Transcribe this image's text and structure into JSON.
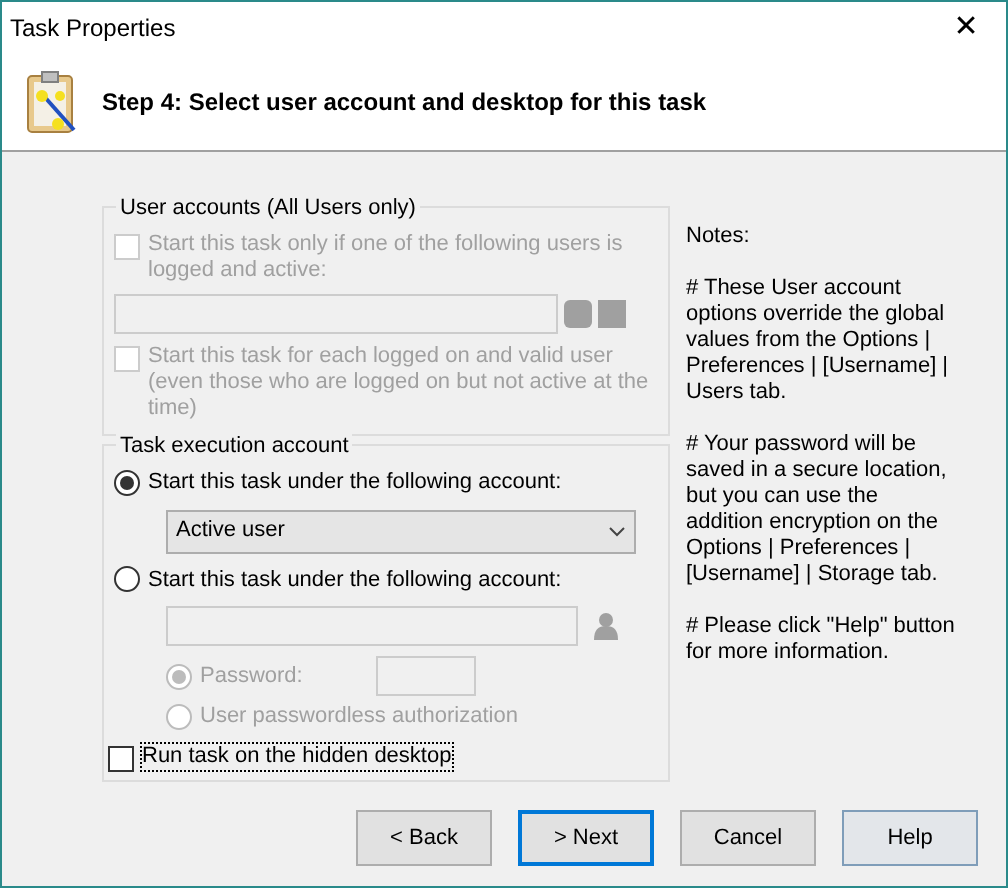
{
  "window": {
    "title": "Task Properties",
    "close": "✕"
  },
  "header": {
    "title": "Step 4: Select user account and desktop for this task"
  },
  "user_accounts": {
    "legend": "User accounts (All Users only)",
    "only_if_active": {
      "label": "Start this task only if one of the following users is logged and active:",
      "checked": false,
      "disabled": true
    },
    "users_field": {
      "disabled": true
    },
    "each_user": {
      "label": "Start this task for each logged on and valid user (even those who are logged on but not active at the time)",
      "checked": false,
      "disabled": true
    }
  },
  "execution": {
    "legend": "Task execution account",
    "options": [
      {
        "label": "Start this task under the following account:",
        "selected": true
      },
      {
        "label": "Start this task under the following account:",
        "selected": false
      }
    ],
    "account_dropdown": {
      "value": "Active user"
    },
    "account_field": {
      "disabled": true
    },
    "auth": [
      {
        "label": "Password:",
        "selected": true,
        "disabled": true
      },
      {
        "label": "User passwordless authorization",
        "selected": false,
        "disabled": true
      }
    ],
    "password_field": {
      "disabled": true
    },
    "hidden_desktop": {
      "label": "Run task on the hidden desktop",
      "checked": false
    }
  },
  "notes": {
    "title": "Notes:",
    "paragraphs": [
      "# These User account options override the global values from the Options | Preferences | [Username] | Users tab.",
      "# Your password will be saved in a secure location, but you can use the addition encryption on the Options | Preferences | [Username] | Storage tab.",
      "# Please click \"Help\" button for more information."
    ]
  },
  "buttons": [
    {
      "label": "< Back",
      "default": false,
      "hovered": false
    },
    {
      "label": "> Next",
      "default": true,
      "hovered": false
    },
    {
      "label": "Cancel",
      "default": false,
      "hovered": false
    },
    {
      "label": "Help",
      "default": false,
      "hovered": true
    }
  ]
}
